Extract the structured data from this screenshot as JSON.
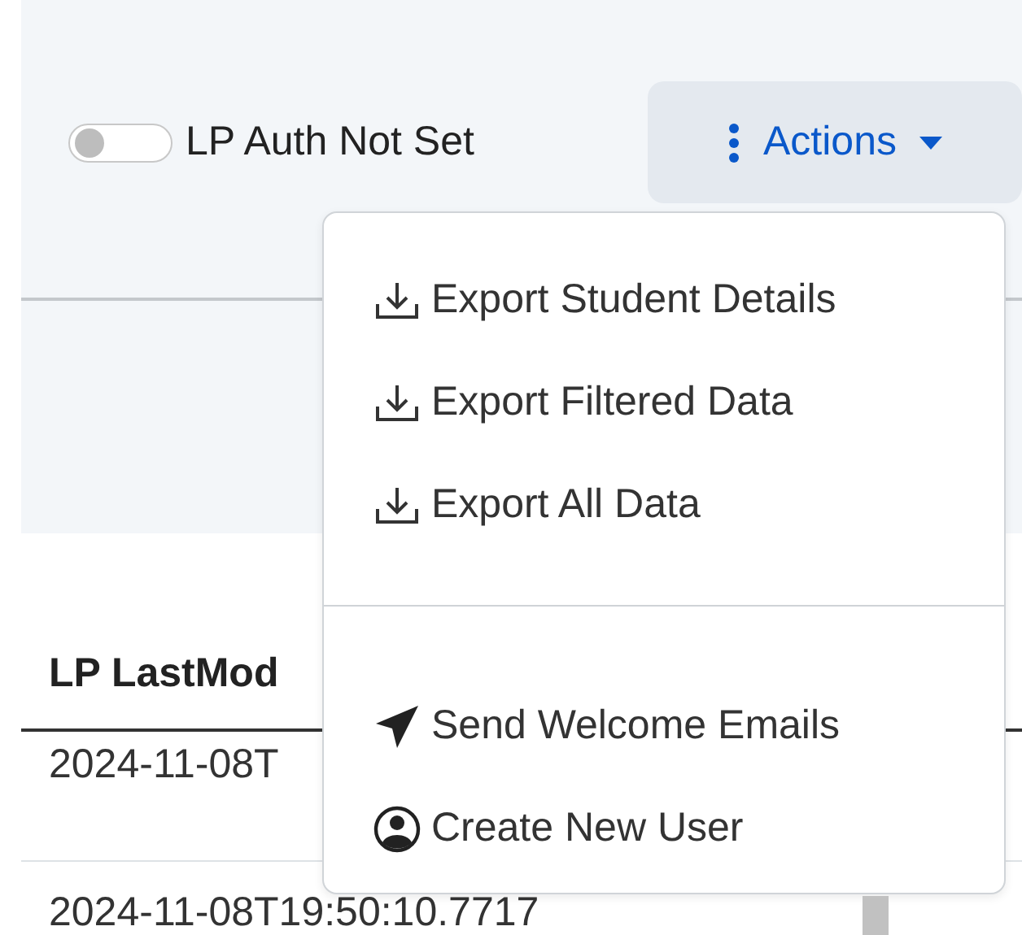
{
  "toggle": {
    "label": "LP Auth Not Set",
    "on": false
  },
  "actions_button": {
    "label": "Actions",
    "expanded": true
  },
  "menu": {
    "groups": [
      [
        {
          "kind": "download",
          "label": "Export Student Details"
        },
        {
          "kind": "download",
          "label": "Export Filtered Data"
        },
        {
          "kind": "download",
          "label": "Export All Data"
        }
      ],
      [
        {
          "kind": "send",
          "label": "Send Welcome Emails"
        },
        {
          "kind": "user",
          "label": "Create New User"
        }
      ]
    ]
  },
  "table": {
    "columns": [
      "LP LastMod"
    ],
    "rows": [
      [
        "2024-11-08T"
      ],
      [
        "2024-11-08T19:50:10.7717"
      ]
    ]
  }
}
